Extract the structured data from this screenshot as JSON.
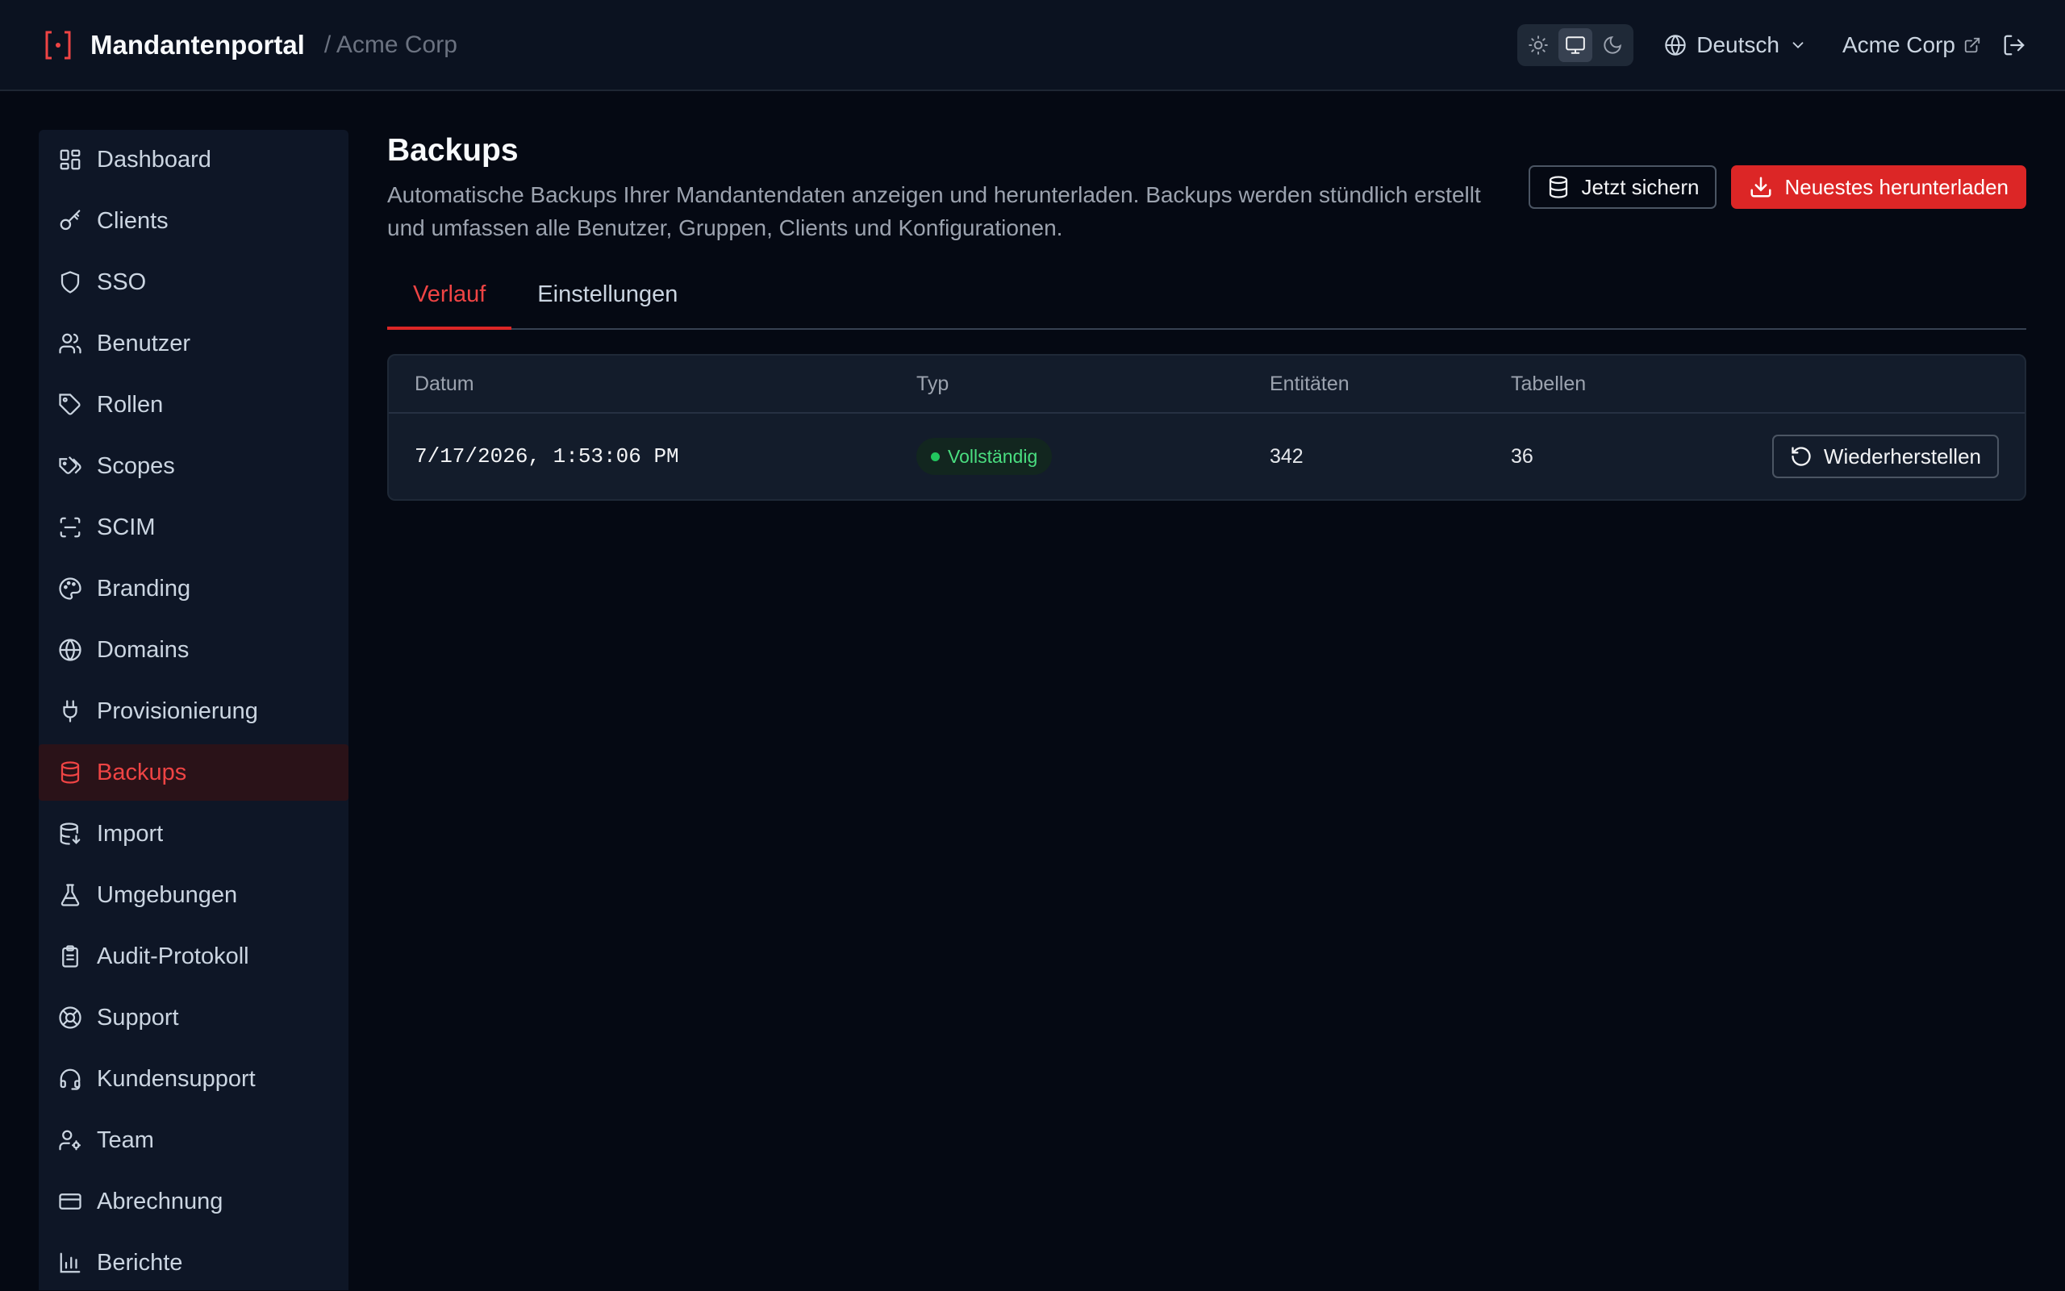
{
  "header": {
    "app_name": "Mandantenportal",
    "breadcrumb_tenant": "/ Acme Corp",
    "language": "Deutsch",
    "tenant_link": "Acme Corp",
    "accent_color": "#dc2626"
  },
  "sidebar": {
    "items": [
      {
        "label": "Dashboard",
        "icon": "dashboard-icon"
      },
      {
        "label": "Clients",
        "icon": "key-icon"
      },
      {
        "label": "SSO",
        "icon": "shield-icon"
      },
      {
        "label": "Benutzer",
        "icon": "users-icon"
      },
      {
        "label": "Rollen",
        "icon": "tag-icon"
      },
      {
        "label": "Scopes",
        "icon": "tags-icon"
      },
      {
        "label": "SCIM",
        "icon": "scan-icon"
      },
      {
        "label": "Branding",
        "icon": "palette-icon"
      },
      {
        "label": "Domains",
        "icon": "globe-icon"
      },
      {
        "label": "Provisionierung",
        "icon": "plug-icon"
      },
      {
        "label": "Backups",
        "icon": "database-icon",
        "active": true
      },
      {
        "label": "Import",
        "icon": "database-import-icon"
      },
      {
        "label": "Umgebungen",
        "icon": "flask-icon"
      },
      {
        "label": "Audit-Protokoll",
        "icon": "clipboard-icon"
      },
      {
        "label": "Support",
        "icon": "lifebuoy-icon"
      },
      {
        "label": "Kundensupport",
        "icon": "headset-icon"
      },
      {
        "label": "Team",
        "icon": "user-cog-icon"
      },
      {
        "label": "Abrechnung",
        "icon": "credit-card-icon"
      },
      {
        "label": "Berichte",
        "icon": "bar-chart-icon"
      }
    ]
  },
  "page": {
    "title": "Backups",
    "description": "Automatische Backups Ihrer Mandantendaten anzeigen und herunterladen. Backups werden stündlich erstellt und umfassen alle Benutzer, Gruppen, Clients und Konfigurationen.",
    "backup_now_label": "Jetzt sichern",
    "download_latest_label": "Neuestes herunterladen"
  },
  "tabs": [
    {
      "label": "Verlauf",
      "active": true
    },
    {
      "label": "Einstellungen",
      "active": false
    }
  ],
  "table": {
    "columns": [
      "Datum",
      "Typ",
      "Entitäten",
      "Tabellen"
    ],
    "rows": [
      {
        "date": "7/17/2026, 1:53:06 PM",
        "type": "Vollständig",
        "entities": "342",
        "tables": "36",
        "action": "Wiederherstellen"
      }
    ]
  }
}
